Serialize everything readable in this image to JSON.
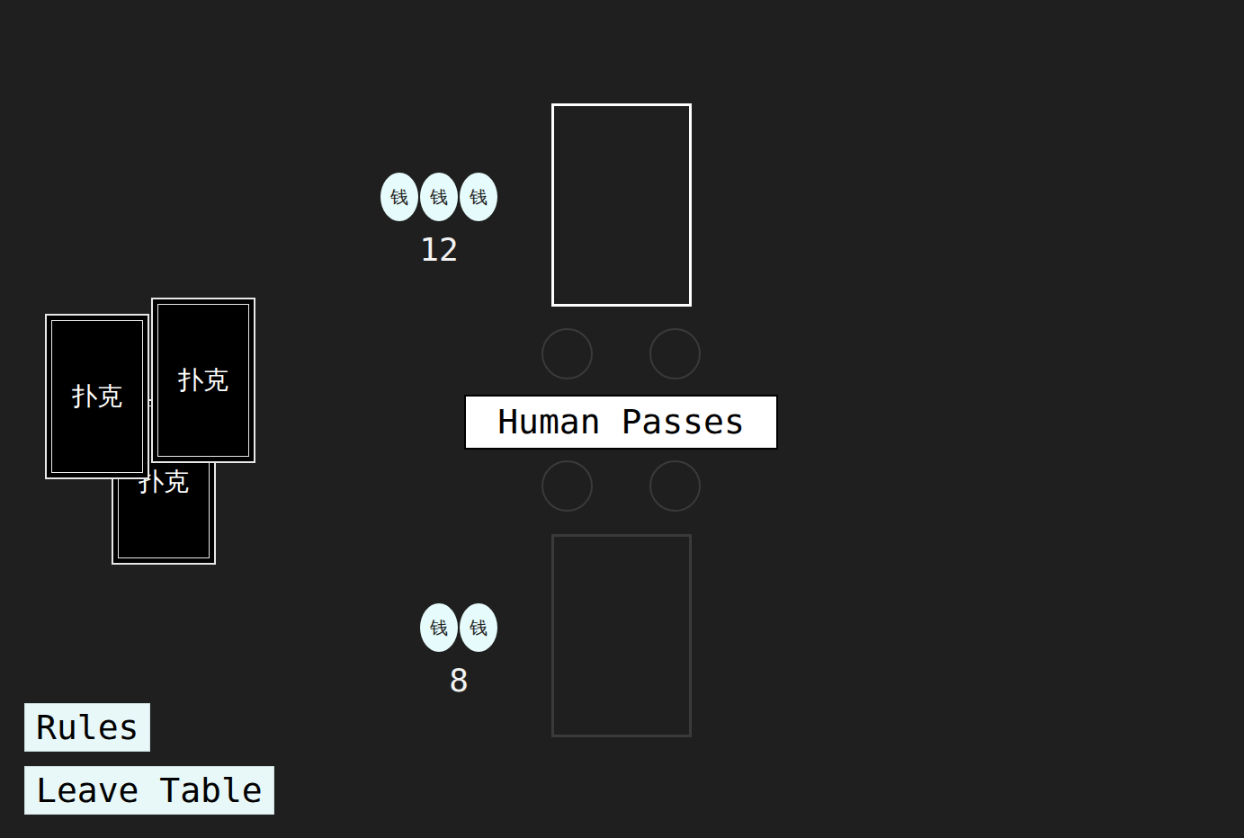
{
  "deck": {
    "cards": [
      {
        "label": "扑克"
      },
      {
        "label": "扑克"
      },
      {
        "label": "扑克"
      }
    ]
  },
  "opponent": {
    "chips": [
      "钱",
      "钱",
      "钱"
    ],
    "amount": "12",
    "slot_active": true
  },
  "player": {
    "chips": [
      "钱",
      "钱"
    ],
    "amount": "8",
    "slot_active": false
  },
  "bet_spots": [
    {
      "filled": false
    },
    {
      "filled": false
    },
    {
      "filled": false
    },
    {
      "filled": false
    }
  ],
  "message": "Human Passes",
  "buttons": [
    "Rules",
    "Leave Table"
  ]
}
